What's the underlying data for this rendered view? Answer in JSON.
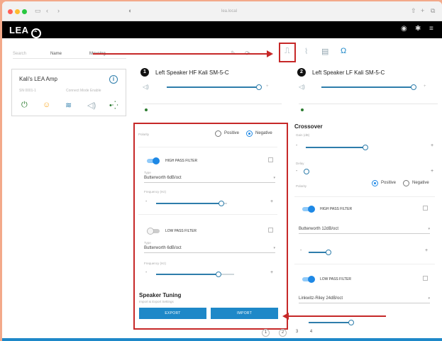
{
  "browser": {
    "url": "lea.local"
  },
  "app": {
    "brand": "LEA"
  },
  "device_bar": {
    "label1": "Search",
    "label2": "Name",
    "label3": "Moveing"
  },
  "device_card": {
    "title": "Kali's LEA Amp",
    "subtitle": "SN 0001-1",
    "status": "Connect Mode Enable"
  },
  "channel1": {
    "number": "1",
    "title": "Left Speaker HF Kali SM-5-C"
  },
  "channel2": {
    "number": "2",
    "title": "Left Speaker LF Kali SM-5-C"
  },
  "polarity": {
    "label": "Polarity",
    "positive": "Positive",
    "negative": "Negative"
  },
  "highpass": {
    "label": "HIGH PASS FILTER",
    "type_label": "Type",
    "type_value": "Butterworth 6dB/oct",
    "freq_label": "Frequency (Hz)",
    "freq_fraction": 0.92
  },
  "lowpass": {
    "label": "LOW PASS FILTER",
    "type_label": "Type",
    "type_value": "Butterworth 6dB/oct",
    "freq_label": "Frequency (Hz)",
    "freq_fraction": 0.8
  },
  "tuning": {
    "title": "Speaker Tuning",
    "subtitle": "Import & Export Settings",
    "export": "EXPORT",
    "import": "IMPORT"
  },
  "crossover": {
    "title": "Crossover",
    "gain_label": "Gain (dB)",
    "delay_label": "Delay",
    "polarity_label": "Polarity",
    "positive": "Positive",
    "negative": "Negative",
    "hp_label": "HIGH PASS FILTER",
    "hp_type": "Butterworth 12dB/oct",
    "lp_label": "LOW PASS FILTER",
    "lp_type": "Linkwitz-Riley 24dB/oct"
  },
  "pages": [
    "1",
    "2",
    "3",
    "4"
  ],
  "colors": {
    "accent": "#1e88c8",
    "annotation": "#c62828",
    "green": "#2e7d32"
  }
}
